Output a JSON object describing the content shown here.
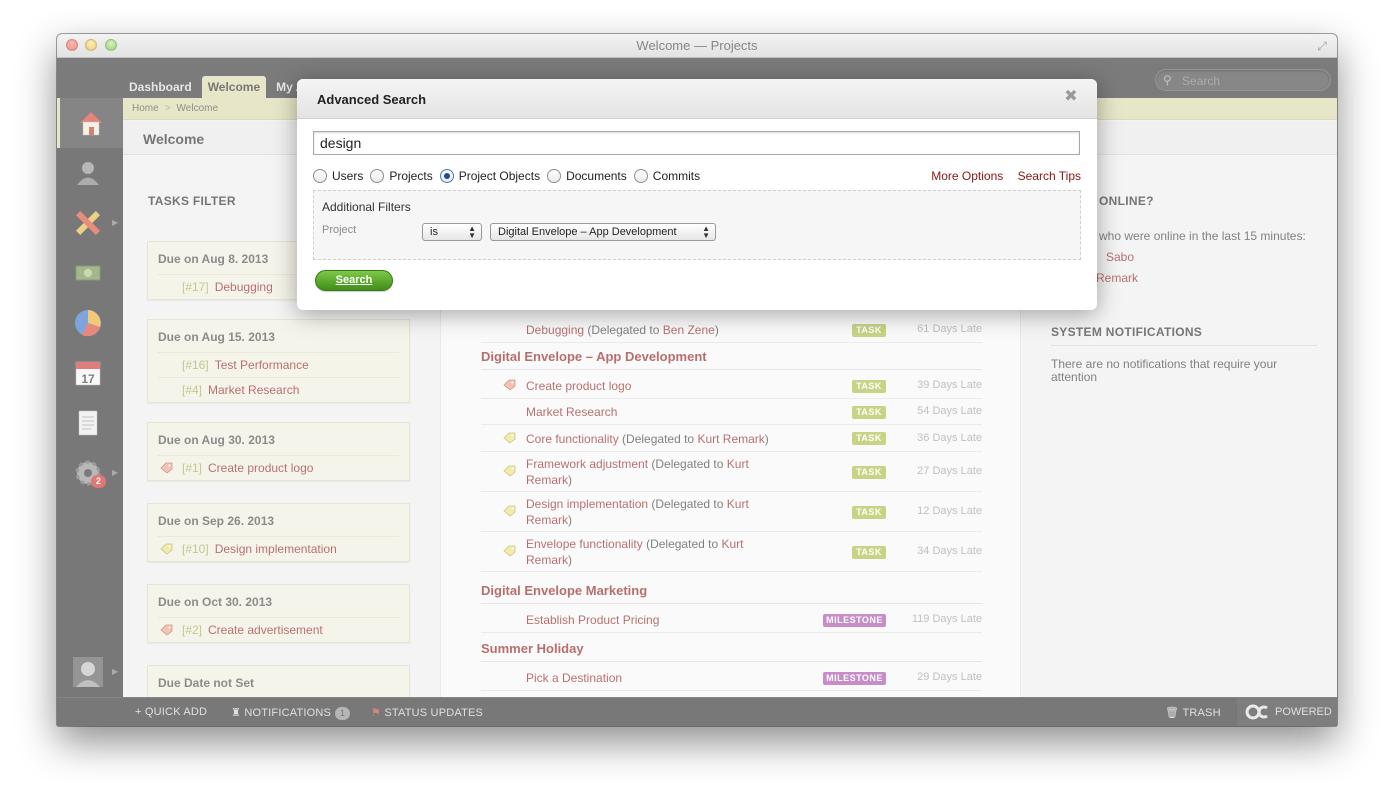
{
  "window": {
    "title": "Welcome — Projects"
  },
  "topbar": {
    "tabs": [
      {
        "label": "Dashboard"
      },
      {
        "label": "Welcome"
      },
      {
        "label": "My As"
      }
    ],
    "search_placeholder": "Search"
  },
  "sidebar": {
    "settings_badge": "2"
  },
  "breadcrumb": {
    "home": "Home",
    "current": "Welcome"
  },
  "page": {
    "title": "Welcome"
  },
  "tasks_filter": {
    "title": "TASKS FILTER",
    "groups": [
      {
        "heading": "Due on Aug 8. 2013",
        "items": [
          {
            "num": "[#17]",
            "name": "Debugging"
          }
        ]
      },
      {
        "heading": "Due on Aug 15. 2013",
        "items": [
          {
            "num": "[#16]",
            "name": "Test Performance"
          },
          {
            "num": "[#4]",
            "name": "Market Research"
          }
        ]
      },
      {
        "heading": "Due on Aug 30. 2013",
        "items": [
          {
            "num": "[#1]",
            "name": "Create product logo"
          }
        ]
      },
      {
        "heading": "Due on Sep 26. 2013",
        "items": [
          {
            "num": "[#10]",
            "name": "Design implementation"
          }
        ]
      },
      {
        "heading": "Due on Oct 30. 2013",
        "items": [
          {
            "num": "[#2]",
            "name": "Create advertisement"
          }
        ]
      },
      {
        "heading": "Due Date not Set",
        "items": []
      }
    ]
  },
  "main": {
    "rows": [
      {
        "name": "Debugging",
        "delegated_prefix": " (Delegated to ",
        "delegated_to": "Ben Zene",
        "delegated_suffix": ")",
        "badge": "TASK",
        "late": "61 Days Late"
      },
      {
        "group": "Digital Envelope – App Development"
      },
      {
        "name": "Create product logo",
        "badge": "TASK",
        "late": "39 Days Late"
      },
      {
        "name": "Market Research",
        "badge": "TASK",
        "late": "54 Days Late"
      },
      {
        "name": "Core functionality",
        "delegated_prefix": " (Delegated to ",
        "delegated_to": "Kurt Remark",
        "delegated_suffix": ")",
        "badge": "TASK",
        "late": "36 Days Late"
      },
      {
        "name": "Framework adjustment",
        "delegated_prefix": " (Delegated to ",
        "delegated_to": "Kurt Remark",
        "delegated_suffix": ")",
        "badge": "TASK",
        "late": "27 Days Late"
      },
      {
        "name": "Design implementation",
        "delegated_prefix": " (Delegated to ",
        "delegated_to": "Kurt Remark",
        "delegated_suffix": ")",
        "badge": "TASK",
        "late": "12 Days Late"
      },
      {
        "name": "Envelope functionality",
        "delegated_prefix": " (Delegated to ",
        "delegated_to": "Kurt Remark",
        "delegated_suffix": ")",
        "badge": "TASK",
        "late": "34 Days Late"
      },
      {
        "group": "Digital Envelope Marketing"
      },
      {
        "name": "Establish Product Pricing",
        "badge": "MILESTONE",
        "late": "119 Days Late"
      },
      {
        "group": "Summer Holiday"
      },
      {
        "name": "Pick a Destination",
        "badge": "MILESTONE",
        "late": "29 Days Late"
      }
    ]
  },
  "right": {
    "online_title": "ONLINE?",
    "online_text": "who were online in the last 15 minutes:",
    "online_users": [
      "Sabo",
      "Remark"
    ],
    "notifications_title": "SYSTEM NOTIFICATIONS",
    "notifications_text": "There are no notifications that require your attention"
  },
  "bottombar": {
    "quick_add": "QUICK ADD",
    "notifications": "NOTIFICATIONS",
    "notifications_count": "1",
    "status_updates": "STATUS UPDATES",
    "trash": "TRASH",
    "powered": "POWERED"
  },
  "modal": {
    "title": "Advanced Search",
    "query": "design",
    "radios": [
      {
        "label": "Users",
        "checked": false
      },
      {
        "label": "Projects",
        "checked": false
      },
      {
        "label": "Project Objects",
        "checked": true
      },
      {
        "label": "Documents",
        "checked": false
      },
      {
        "label": "Commits",
        "checked": false
      }
    ],
    "more_options": "More Options",
    "search_tips": "Search Tips",
    "filters_title": "Additional Filters",
    "filter_label": "Project",
    "operator_value": "is",
    "project_value": "Digital Envelope – App Development",
    "search_button": "Search"
  },
  "colors": {
    "accent": "#d8d7a6",
    "link": "#8b1414",
    "task": "#a7b83a",
    "milestone": "#a347a8",
    "button": "#4fa52a"
  }
}
